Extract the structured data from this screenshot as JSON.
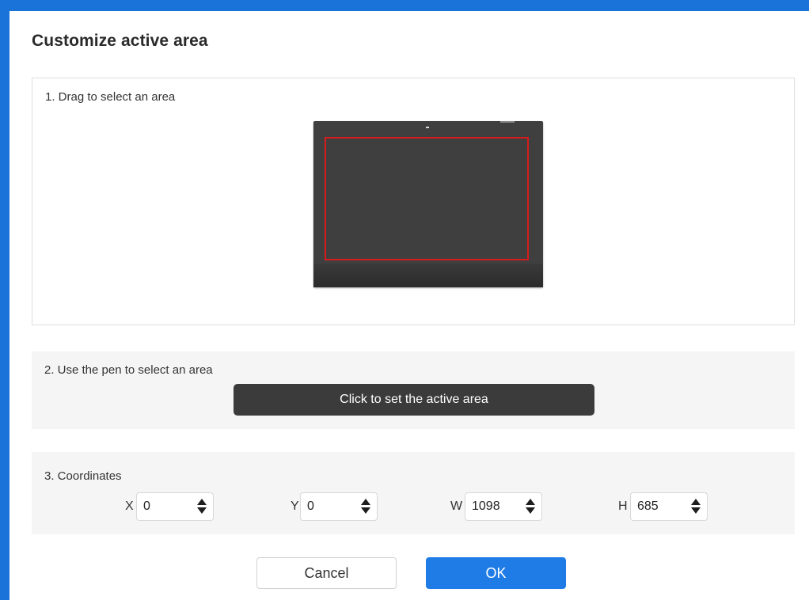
{
  "dialog": {
    "title": "Customize active area"
  },
  "colors": {
    "accent": "#1f7ce6",
    "window_frame": "#1a73d9",
    "tablet_body": "#3f3f3f",
    "selection_outline": "#d51b1b",
    "dark_button": "#3b3b3b"
  },
  "drag_section": {
    "label": "1. Drag to select an area"
  },
  "pen_section": {
    "label": "2. Use the pen to select an area",
    "button_label": "Click to set the active area"
  },
  "coordinates_section": {
    "label": "3. Coordinates",
    "fields": [
      {
        "letter": "X",
        "value": "0"
      },
      {
        "letter": "Y",
        "value": "0"
      },
      {
        "letter": "W",
        "value": "1098"
      },
      {
        "letter": "H",
        "value": "685"
      }
    ]
  },
  "footer": {
    "cancel_label": "Cancel",
    "ok_label": "OK"
  }
}
